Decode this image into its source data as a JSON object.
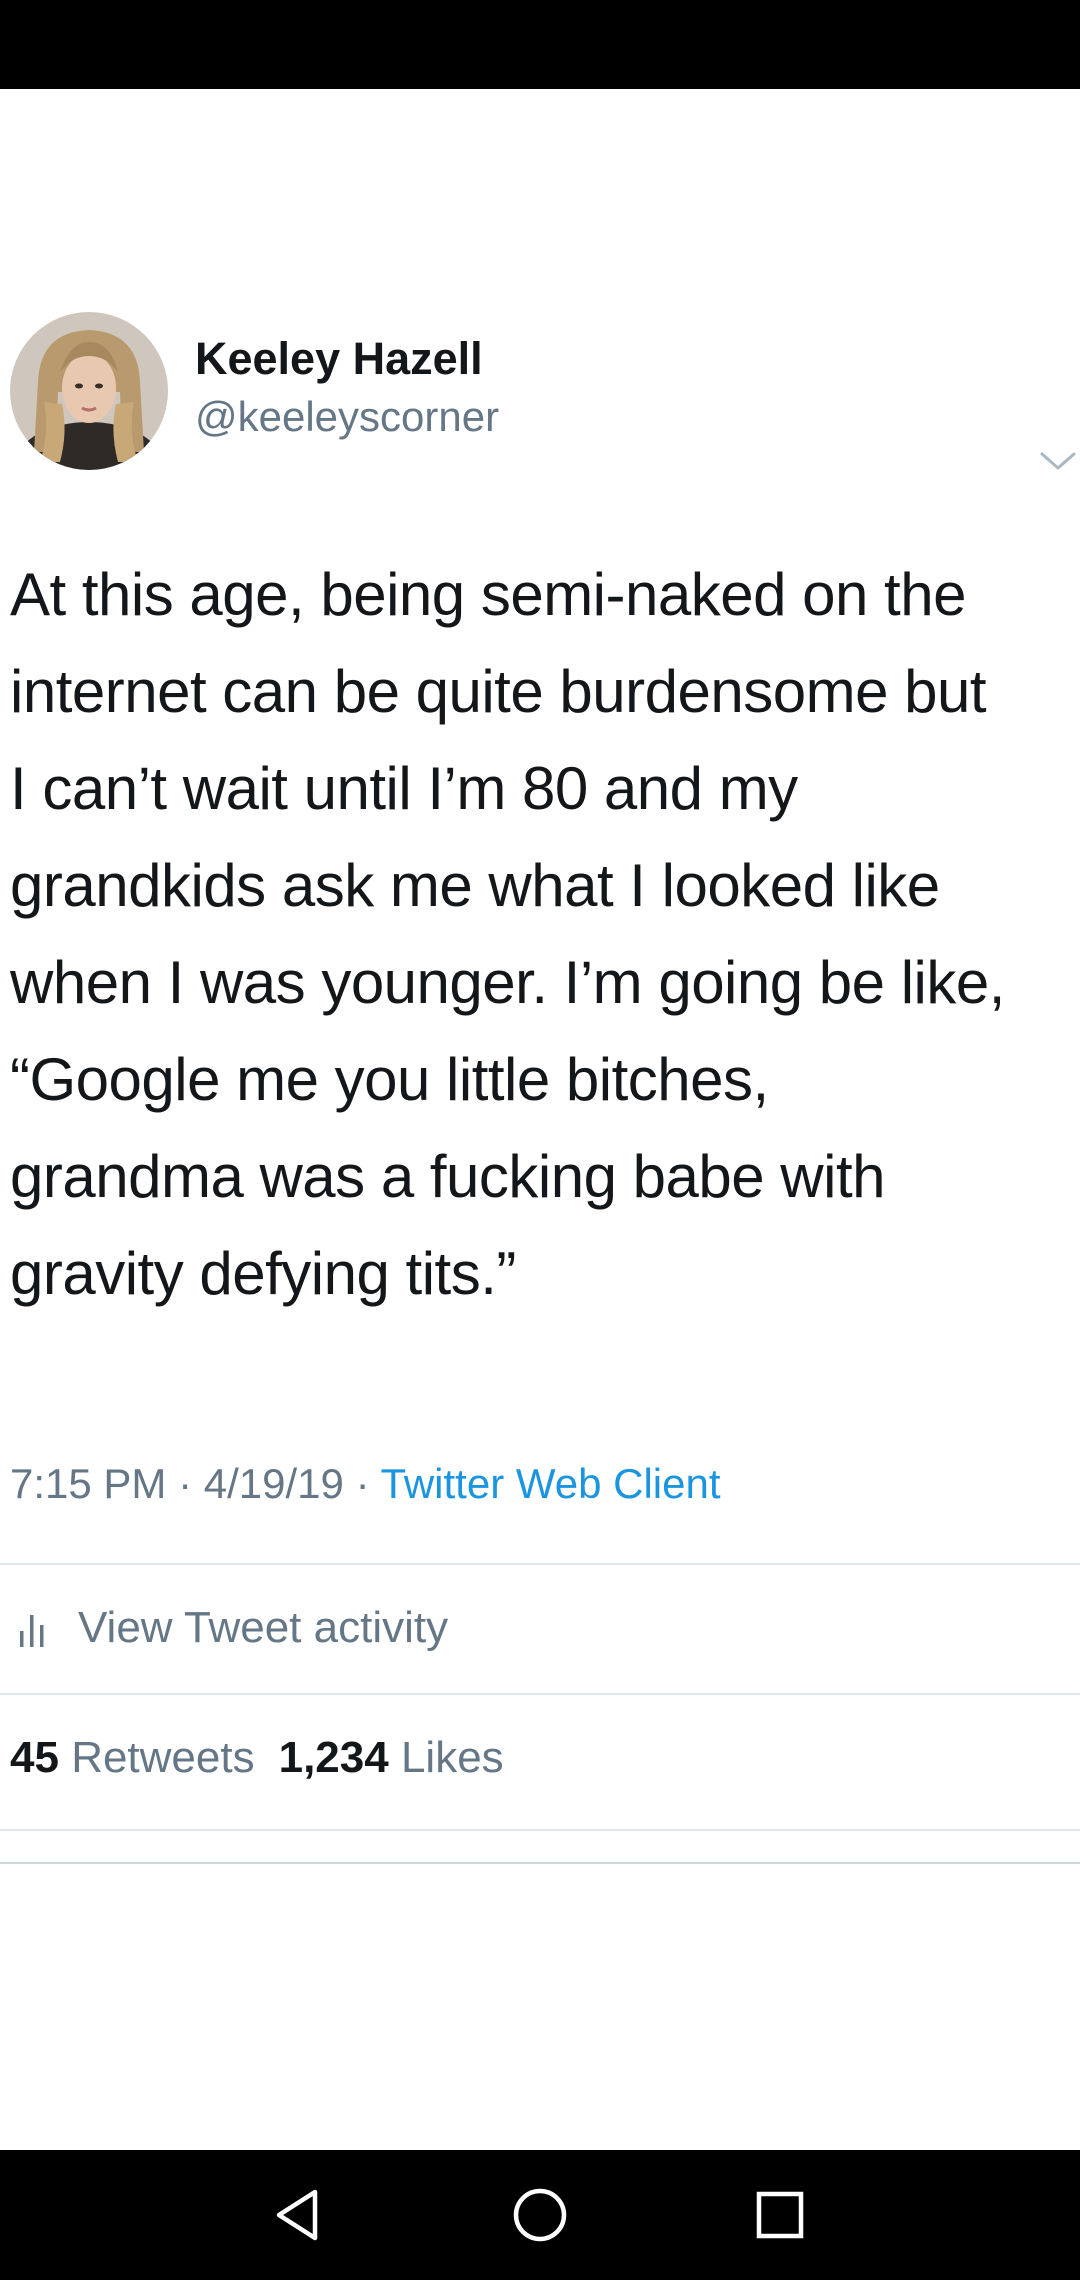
{
  "author": {
    "name": "Keeley Hazell",
    "handle": "@keeleyscorner",
    "avatar_icon": "profile-photo",
    "menu_icon": "chevron-down-icon"
  },
  "tweet": {
    "lines": [
      "At this age, being semi-naked on the",
      "internet can be quite burdensome but",
      "I can’t wait until I’m 80 and my",
      "grandkids ask me what I looked like",
      "when I was younger. I’m going be like,",
      "“Google me you little bitches,",
      "grandma was a fucking babe with",
      "gravity defying tits.”"
    ],
    "time": "7:15 PM",
    "date": "4/19/19",
    "separator": "·",
    "source": "Twitter Web Client"
  },
  "activity": {
    "label": "View Tweet activity",
    "icon": "bar-chart-icon"
  },
  "stats": {
    "retweets_count": "45",
    "retweets_label": "Retweets",
    "likes_count": "1,234",
    "likes_label": "Likes"
  },
  "navigation": {
    "back_icon": "back-triangle-icon",
    "home_icon": "home-circle-icon",
    "recents_icon": "recents-square-icon"
  },
  "colors": {
    "text": "#14171a",
    "secondary": "#657786",
    "link": "#1b95e0",
    "divider": "#e1e8ed",
    "system_bars": "#000000"
  }
}
